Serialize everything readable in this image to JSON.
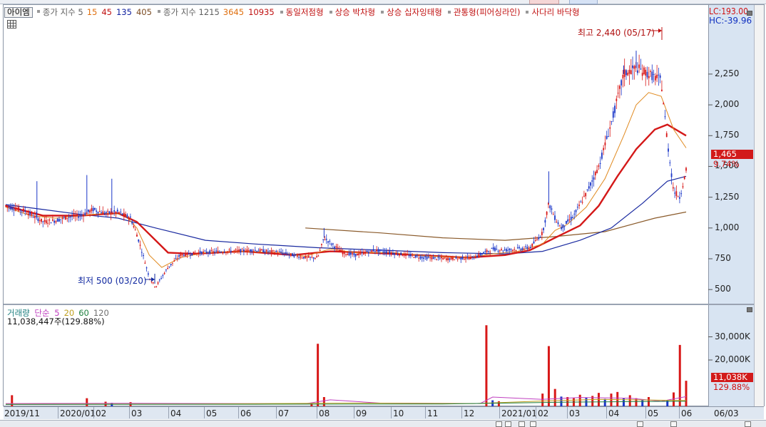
{
  "legend": {
    "indicator_button": "아이엠",
    "ma_label_1": "종가 지수 5",
    "ma_1": [
      {
        "text": "15",
        "color": "#e07010"
      },
      {
        "text": "45",
        "color": "#c01010"
      },
      {
        "text": "135",
        "color": "#1020a0"
      },
      {
        "text": "405",
        "color": "#7a4a20"
      }
    ],
    "ma_label_2": "종가 지수 1215",
    "ma_2": [
      {
        "text": "3645",
        "color": "#e07010"
      },
      {
        "text": "10935",
        "color": "#c01010"
      }
    ],
    "patterns": [
      "동일저점형",
      "상승 박차형",
      "상승 십자잉태형",
      "관통형(피어싱라인)",
      "사다리 바닥형"
    ]
  },
  "axis_labels": {
    "lc": "LC:193.00",
    "hc": "HC:-39.96"
  },
  "price_badge": {
    "value": "1,465",
    "percent": "9.74%"
  },
  "volume_badge": {
    "value": "11,038K",
    "percent": "129.88%"
  },
  "annotations": {
    "high": "최고 2,440 (05/17)",
    "low": "최저 500 (03/20)"
  },
  "volume_legend": {
    "title": "거래량",
    "simple": "단순",
    "periods": [
      {
        "text": "5",
        "color": "#c040c0"
      },
      {
        "text": "20",
        "color": "#c0a020"
      },
      {
        "text": "60",
        "color": "#208040"
      },
      {
        "text": "120",
        "color": "#707070"
      }
    ],
    "info": "11,038,447주(129.88%)"
  },
  "chart_data": {
    "type": "candlestick",
    "y_ticks": [
      "2,250",
      "2,000",
      "1,750",
      "1,500",
      "1,250",
      "1,000",
      "750",
      "500"
    ],
    "ylim": [
      420,
      2620
    ],
    "volume_ticks": [
      "30,000K",
      "20,000K"
    ],
    "volume_ylim": [
      0,
      40000
    ],
    "x_ticks": [
      "2019/11",
      "2020/01",
      "02",
      "03",
      "04",
      "05",
      "06",
      "07",
      "08",
      "09",
      "10",
      "11",
      "12",
      "2021/01",
      "02",
      "03",
      "04",
      "05",
      "06",
      "06/03"
    ],
    "price_path": [
      [
        0,
        1180
      ],
      [
        3,
        1140
      ],
      [
        6,
        1050
      ],
      [
        8,
        1060
      ],
      [
        10,
        1090
      ],
      [
        12,
        1100
      ],
      [
        14,
        1150
      ],
      [
        16,
        1120
      ],
      [
        18,
        1130
      ],
      [
        20,
        1080
      ],
      [
        21,
        950
      ],
      [
        22,
        780
      ],
      [
        23,
        600
      ],
      [
        24,
        520
      ],
      [
        25,
        600
      ],
      [
        26,
        680
      ],
      [
        28,
        780
      ],
      [
        31,
        800
      ],
      [
        35,
        810
      ],
      [
        40,
        820
      ],
      [
        44,
        800
      ],
      [
        48,
        760
      ],
      [
        50,
        760
      ],
      [
        51,
        920
      ],
      [
        52,
        880
      ],
      [
        54,
        800
      ],
      [
        56,
        780
      ],
      [
        59,
        820
      ],
      [
        63,
        790
      ],
      [
        67,
        760
      ],
      [
        71,
        750
      ],
      [
        75,
        760
      ],
      [
        78,
        830
      ],
      [
        80,
        820
      ],
      [
        84,
        840
      ],
      [
        86,
        960
      ],
      [
        87,
        1200
      ],
      [
        88,
        1080
      ],
      [
        89,
        1000
      ],
      [
        91,
        1100
      ],
      [
        93,
        1280
      ],
      [
        95,
        1500
      ],
      [
        97,
        1850
      ],
      [
        99,
        2250
      ],
      [
        101,
        2300
      ],
      [
        103,
        2250
      ],
      [
        105,
        2200
      ],
      [
        106,
        1700
      ],
      [
        107,
        1300
      ],
      [
        108,
        1250
      ],
      [
        109,
        1465
      ]
    ],
    "ma_short_path": [
      [
        0,
        1170
      ],
      [
        4,
        1100
      ],
      [
        8,
        1080
      ],
      [
        12,
        1100
      ],
      [
        16,
        1120
      ],
      [
        19,
        1110
      ],
      [
        21,
        1000
      ],
      [
        23,
        780
      ],
      [
        25,
        680
      ],
      [
        28,
        760
      ],
      [
        32,
        800
      ],
      [
        38,
        810
      ],
      [
        44,
        800
      ],
      [
        48,
        770
      ],
      [
        52,
        830
      ],
      [
        56,
        800
      ],
      [
        62,
        800
      ],
      [
        68,
        770
      ],
      [
        74,
        760
      ],
      [
        78,
        790
      ],
      [
        82,
        810
      ],
      [
        86,
        870
      ],
      [
        88,
        980
      ],
      [
        90,
        1030
      ],
      [
        93,
        1170
      ],
      [
        96,
        1400
      ],
      [
        99,
        1750
      ],
      [
        101,
        2000
      ],
      [
        103,
        2100
      ],
      [
        105,
        2070
      ],
      [
        107,
        1800
      ],
      [
        109,
        1650
      ]
    ],
    "ma_mid_path": [
      [
        0,
        1180
      ],
      [
        6,
        1100
      ],
      [
        12,
        1100
      ],
      [
        18,
        1120
      ],
      [
        21,
        1050
      ],
      [
        24,
        900
      ],
      [
        26,
        800
      ],
      [
        30,
        790
      ],
      [
        38,
        810
      ],
      [
        46,
        780
      ],
      [
        52,
        810
      ],
      [
        58,
        800
      ],
      [
        66,
        780
      ],
      [
        74,
        760
      ],
      [
        80,
        780
      ],
      [
        84,
        820
      ],
      [
        88,
        920
      ],
      [
        92,
        1020
      ],
      [
        95,
        1180
      ],
      [
        98,
        1420
      ],
      [
        101,
        1640
      ],
      [
        104,
        1800
      ],
      [
        106,
        1840
      ],
      [
        109,
        1750
      ]
    ],
    "ma_long_path": [
      [
        0,
        1190
      ],
      [
        6,
        1150
      ],
      [
        12,
        1110
      ],
      [
        18,
        1080
      ],
      [
        24,
        1000
      ],
      [
        32,
        900
      ],
      [
        40,
        870
      ],
      [
        50,
        840
      ],
      [
        60,
        820
      ],
      [
        70,
        800
      ],
      [
        80,
        790
      ],
      [
        86,
        810
      ],
      [
        92,
        900
      ],
      [
        97,
        1000
      ],
      [
        102,
        1200
      ],
      [
        106,
        1380
      ],
      [
        109,
        1420
      ]
    ],
    "ma_vlong_path": [
      [
        48,
        1000
      ],
      [
        60,
        960
      ],
      [
        70,
        920
      ],
      [
        80,
        900
      ],
      [
        88,
        930
      ],
      [
        96,
        970
      ],
      [
        104,
        1080
      ],
      [
        109,
        1130
      ]
    ],
    "volume_bars": [
      [
        1,
        4800,
        "r"
      ],
      [
        13,
        3500,
        "r"
      ],
      [
        16,
        2000,
        "r"
      ],
      [
        17,
        1500,
        "b"
      ],
      [
        20,
        1800,
        "r"
      ],
      [
        49,
        1200,
        "r"
      ],
      [
        50,
        27000,
        "r"
      ],
      [
        51,
        4000,
        "r"
      ],
      [
        77,
        35000,
        "r"
      ],
      [
        78,
        2600,
        "b"
      ],
      [
        79,
        2200,
        "r"
      ],
      [
        86,
        5500,
        "r"
      ],
      [
        87,
        26000,
        "r"
      ],
      [
        88,
        7500,
        "r"
      ],
      [
        89,
        4200,
        "b"
      ],
      [
        90,
        4000,
        "r"
      ],
      [
        91,
        3500,
        "r"
      ],
      [
        92,
        5000,
        "r"
      ],
      [
        93,
        3800,
        "b"
      ],
      [
        94,
        4500,
        "r"
      ],
      [
        95,
        5800,
        "r"
      ],
      [
        96,
        3200,
        "b"
      ],
      [
        97,
        5500,
        "r"
      ],
      [
        98,
        6200,
        "r"
      ],
      [
        99,
        3500,
        "b"
      ],
      [
        100,
        4800,
        "r"
      ],
      [
        101,
        3500,
        "r"
      ],
      [
        102,
        2800,
        "b"
      ],
      [
        103,
        4000,
        "r"
      ],
      [
        106,
        2500,
        "b"
      ],
      [
        107,
        6000,
        "r"
      ],
      [
        108,
        26500,
        "r"
      ],
      [
        109,
        11038,
        "r"
      ]
    ]
  }
}
